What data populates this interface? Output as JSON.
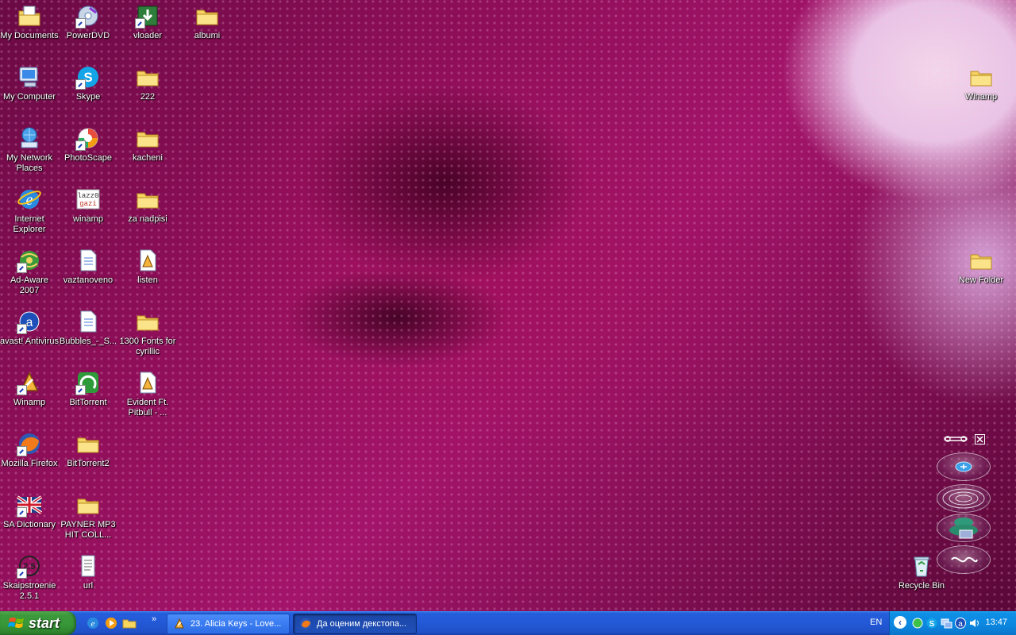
{
  "desktop": {
    "wallpaper": "purple-rose-with-water-droplets",
    "icons": [
      {
        "id": "my-documents",
        "label": "My Documents",
        "icon": "my-documents-icon"
      },
      {
        "id": "powerdvd",
        "label": "PowerDVD",
        "icon": "powerdvd-icon"
      },
      {
        "id": "vloader",
        "label": "vloader",
        "icon": "vloader-icon"
      },
      {
        "id": "albumi",
        "label": "albumi",
        "icon": "folder-icon"
      },
      {
        "id": "my-computer",
        "label": "My Computer",
        "icon": "my-computer-icon"
      },
      {
        "id": "skype",
        "label": "Skype",
        "icon": "skype-icon"
      },
      {
        "id": "folder-222",
        "label": "222",
        "icon": "folder-icon"
      },
      {
        "id": "winamp-right",
        "label": "Winamp",
        "icon": "folder-icon"
      },
      {
        "id": "my-network-places",
        "label": "My Network Places",
        "icon": "my-network-places-icon"
      },
      {
        "id": "photoscape",
        "label": "PhotoScape",
        "icon": "photoscape-icon"
      },
      {
        "id": "kacheni",
        "label": "kacheni",
        "icon": "folder-icon"
      },
      {
        "id": "internet-explorer",
        "label": "Internet Explorer",
        "icon": "internet-explorer-icon"
      },
      {
        "id": "winamp-file",
        "label": "winamp",
        "icon": "text-image-icon"
      },
      {
        "id": "za-nadpisi",
        "label": "za nadpisi",
        "icon": "folder-icon"
      },
      {
        "id": "ad-aware",
        "label": "Ad-Aware 2007",
        "icon": "ad-aware-icon"
      },
      {
        "id": "vaztanoveno",
        "label": "vaztanoveno",
        "icon": "document-icon"
      },
      {
        "id": "listen",
        "label": "listen",
        "icon": "winamp-file-icon"
      },
      {
        "id": "new-folder",
        "label": "New Folder",
        "icon": "folder-icon"
      },
      {
        "id": "avast",
        "label": "avast! Antivirus",
        "icon": "avast-icon"
      },
      {
        "id": "bubbles",
        "label": "Bubbles_-_S...",
        "icon": "document-icon"
      },
      {
        "id": "fonts-1300",
        "label": "1300 Fonts for cyrillic",
        "icon": "folder-icon"
      },
      {
        "id": "winamp-shortcut",
        "label": "Winamp",
        "icon": "winamp-icon"
      },
      {
        "id": "bittorrent",
        "label": "BitTorrent",
        "icon": "bittorrent-icon"
      },
      {
        "id": "evident-pitbull",
        "label": "Evident Ft. Pitbull - ...",
        "icon": "winamp-file-icon"
      },
      {
        "id": "mozilla-firefox",
        "label": "Mozilla Firefox",
        "icon": "firefox-icon"
      },
      {
        "id": "bittorrent2",
        "label": "BitTorrent2",
        "icon": "folder-icon"
      },
      {
        "id": "sa-dictionary",
        "label": "SA Dictionary",
        "icon": "uk-flag-icon"
      },
      {
        "id": "payner",
        "label": "PAYNER MP3 HIT COLL...",
        "icon": "folder-icon"
      },
      {
        "id": "recycle-bin",
        "label": "Recycle Bin",
        "icon": "recycle-bin-icon"
      },
      {
        "id": "skaipstroenie",
        "label": "Skaipstroenie 2.5.1",
        "icon": "skaipstroenie-icon"
      },
      {
        "id": "url",
        "label": "url",
        "icon": "text-file-icon"
      }
    ]
  },
  "gadget": {
    "icons": [
      "wrench-icon",
      "close-icon",
      "add-icon",
      "radar-icon",
      "stack-icon",
      "link-icon"
    ]
  },
  "taskbar": {
    "start_label": "start",
    "quick_launch": [
      "internet-explorer-icon",
      "media-player-icon",
      "explorer-folder-icon"
    ],
    "more": "»",
    "tasks": [
      {
        "label": "23. Alicia Keys - Love...",
        "icon": "winamp-icon",
        "active": false
      },
      {
        "label": "Да оценим декстопа...",
        "icon": "firefox-icon",
        "active": true
      }
    ],
    "language": "EN",
    "tray_icons": [
      "tray-chevron-icon",
      "tray-green-icon",
      "tray-skype-icon",
      "tray-network-icon",
      "tray-av-icon",
      "tray-volume-icon"
    ],
    "clock": "13:47"
  }
}
